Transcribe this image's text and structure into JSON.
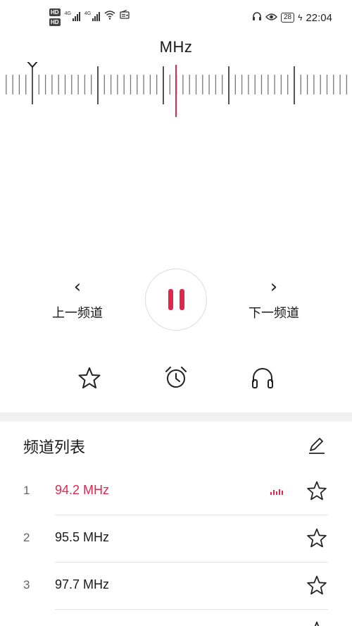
{
  "status_bar": {
    "hd1": "HD",
    "hd2": "HD",
    "net1": "4G",
    "net2": "4G",
    "time": "22:04",
    "battery": "28",
    "icons": [
      "headphone-icon",
      "eye-icon",
      "wifi-icon",
      "radio-icon"
    ]
  },
  "tuner": {
    "unit": "MHz",
    "accent": "#e0284f"
  },
  "controls": {
    "prev_label": "上一频道",
    "next_label": "下一频道",
    "playing": true
  },
  "tools": [
    "star-icon",
    "alarm-clock-icon",
    "headphones-icon"
  ],
  "channel_list": {
    "title": "频道列表",
    "items": [
      {
        "index": "1",
        "freq": "94.2 MHz",
        "active": true
      },
      {
        "index": "2",
        "freq": "95.5 MHz",
        "active": false
      },
      {
        "index": "3",
        "freq": "97.7 MHz",
        "active": false
      }
    ]
  }
}
